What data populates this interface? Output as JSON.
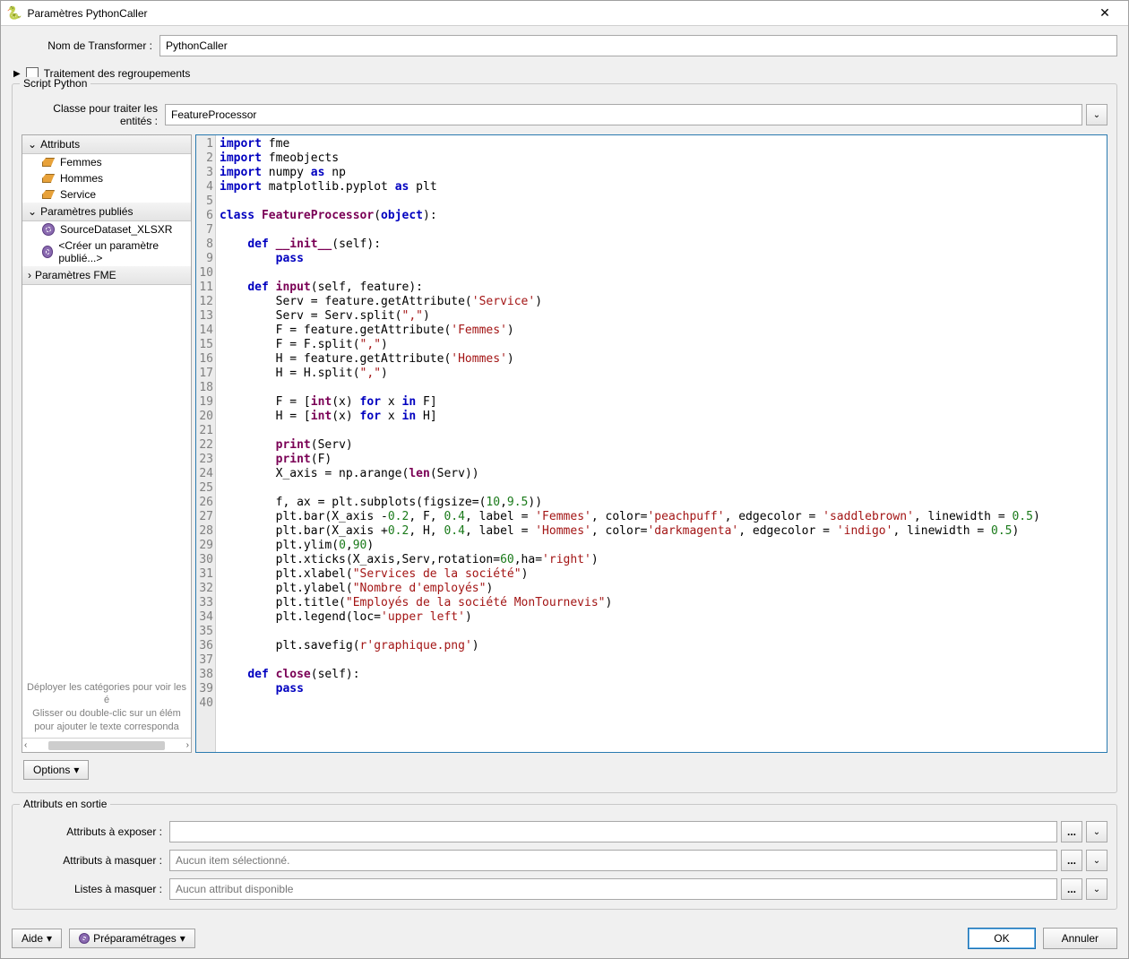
{
  "window": {
    "title": "Paramètres PythonCaller",
    "close": "✕"
  },
  "transformer": {
    "label": "Nom de Transformer :",
    "value": "PythonCaller"
  },
  "grouping": {
    "label": "Traitement des regroupements",
    "arrow": "▶"
  },
  "script": {
    "groupTitle": "Script Python",
    "classLabel": "Classe pour traiter les entités :",
    "classValue": "FeatureProcessor"
  },
  "sidebar": {
    "attributsHeader": "Attributs",
    "attributs": [
      "Femmes",
      "Hommes",
      "Service"
    ],
    "paramsHeader": "Paramètres publiés",
    "params": [
      "SourceDataset_XLSXR",
      "<Créer un paramètre publié...>"
    ],
    "fmeParamsHeader": "Paramètres FME",
    "hint1": "Déployer les catégories pour voir les é",
    "hint2": "Glisser ou double-clic sur un élém",
    "hint3": "pour ajouter le texte corresponda"
  },
  "code_lines": 40,
  "options": {
    "label": "Options",
    "caret": "▾"
  },
  "output": {
    "groupTitle": "Attributs en sortie",
    "exposeLabel": "Attributs à exposer :",
    "exposeValue": "",
    "hideAttrsLabel": "Attributs à masquer :",
    "hideAttrsPlaceholder": "Aucun item sélectionné.",
    "hideListsLabel": "Listes à masquer :",
    "hideListsPlaceholder": "Aucun attribut disponible"
  },
  "footer": {
    "help": "Aide",
    "helpCaret": "▾",
    "presets": "Préparamétrages",
    "presetsCaret": "▾",
    "ok": "OK",
    "cancel": "Annuler"
  },
  "icons": {
    "down": "⌄",
    "right": "›",
    "ellipsis": "..."
  }
}
